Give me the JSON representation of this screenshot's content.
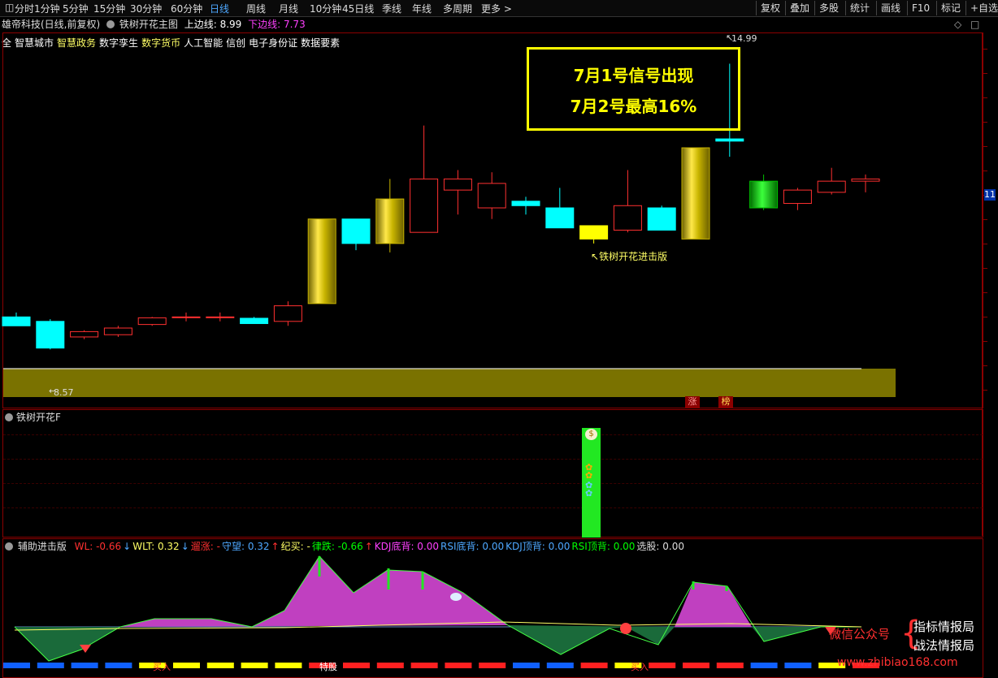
{
  "toolbar": {
    "items": [
      "分时",
      "1分钟",
      "5分钟",
      "15分钟",
      "30分钟",
      "60分钟",
      "日线",
      "周线",
      "月线",
      "10分钟",
      "45日线",
      "季线",
      "年线",
      "多周期",
      "更多 >"
    ],
    "active_index": 6,
    "right_buttons": [
      "复权",
      "叠加",
      "多股",
      "统计",
      "画线",
      "F10",
      "标记",
      "+自选"
    ]
  },
  "info": {
    "stock": "雄帝科技(日线,前复权)",
    "indicator": "铁树开花主图",
    "upper_label": "上边线:",
    "upper_value": "8.99",
    "lower_label": "下边线:",
    "lower_value": "7.73"
  },
  "concepts": [
    {
      "text": "全",
      "hl": false
    },
    {
      "text": "智慧城市",
      "hl": false
    },
    {
      "text": "智慧政务",
      "hl": true
    },
    {
      "text": "数字孪生",
      "hl": false
    },
    {
      "text": "数字货币",
      "hl": true
    },
    {
      "text": "人工智能",
      "hl": false
    },
    {
      "text": "信创",
      "hl": false
    },
    {
      "text": "电子身份证",
      "hl": false
    },
    {
      "text": "数据要素",
      "hl": false
    }
  ],
  "annotation": {
    "line1": "7月1号信号出现",
    "line2": "7月2号最高16%",
    "high_label": "14.99",
    "low_label": "8.57",
    "signal_label": "铁树开花进击版",
    "right_edge_label": "11",
    "tag_zhang": "涨",
    "tag_bang": "榜"
  },
  "colors": {
    "up": "#ff3030",
    "down": "#00ffff",
    "gold": "#c8b400",
    "signal_yellow": "#ffff00",
    "green": "#00c000",
    "band": "#7a7200",
    "magenta": "#c040c0",
    "sub_green": "#1a6a3a"
  },
  "panel2": {
    "title": "铁树开花F"
  },
  "panel3": {
    "title": "辅助进击版",
    "legend": [
      {
        "t": "WL: -0.66",
        "c": "#ff3030"
      },
      {
        "t": "↓",
        "c": "#4ea8ff"
      },
      {
        "t": "WLT: 0.32",
        "c": "#ffff66"
      },
      {
        "t": "↓",
        "c": "#4ea8ff"
      },
      {
        "t": "遛涨: -",
        "c": "#ff3030"
      },
      {
        "t": "守望: 0.32",
        "c": "#4ea8ff"
      },
      {
        "t": "↑",
        "c": "#ff3030"
      },
      {
        "t": "纪买: -",
        "c": "#ffff66"
      },
      {
        "t": "律跌: -0.66",
        "c": "#00ff00"
      },
      {
        "t": "↑",
        "c": "#ff3030"
      },
      {
        "t": "KDJ底背: 0.00",
        "c": "#ff40ff"
      },
      {
        "t": "RSI底背: 0.00",
        "c": "#4ea8ff"
      },
      {
        "t": "KDJ顶背: 0.00",
        "c": "#4ea8ff"
      },
      {
        "t": "RSI顶背: 0.00",
        "c": "#00ff00"
      },
      {
        "t": "选股: 0.00",
        "c": "#dddddd"
      }
    ],
    "bottom_labels": [
      "买入",
      "特股",
      "买入"
    ]
  },
  "watermark": {
    "left": "微信公众号",
    "right1": "指标情报局",
    "right2": "战法情报局",
    "url": "www.zhibiao168.com"
  },
  "chart_data": {
    "type": "candlestick",
    "price_range": [
      7.7,
      15.6
    ],
    "candles": [
      {
        "o": 9.3,
        "c": 9.1,
        "h": 9.4,
        "l": 9.1,
        "kind": "down"
      },
      {
        "o": 9.2,
        "c": 8.6,
        "h": 9.25,
        "l": 8.57,
        "kind": "down"
      },
      {
        "o": 8.85,
        "c": 8.97,
        "h": 9.0,
        "l": 8.8,
        "kind": "up"
      },
      {
        "o": 8.9,
        "c": 9.05,
        "h": 9.1,
        "l": 8.85,
        "kind": "up"
      },
      {
        "o": 9.13,
        "c": 9.28,
        "h": 9.3,
        "l": 9.1,
        "kind": "up"
      },
      {
        "o": 9.3,
        "c": 9.3,
        "h": 9.4,
        "l": 9.2,
        "kind": "flat"
      },
      {
        "o": 9.3,
        "c": 9.3,
        "h": 9.4,
        "l": 9.2,
        "kind": "flat"
      },
      {
        "o": 9.27,
        "c": 9.15,
        "h": 9.3,
        "l": 9.15,
        "kind": "down"
      },
      {
        "o": 9.2,
        "c": 9.55,
        "h": 9.65,
        "l": 9.1,
        "kind": "up"
      },
      {
        "o": 9.6,
        "c": 11.5,
        "h": 11.5,
        "l": 9.6,
        "kind": "gold"
      },
      {
        "o": 11.5,
        "c": 10.95,
        "h": 11.5,
        "l": 10.8,
        "kind": "down"
      },
      {
        "o": 10.95,
        "c": 11.95,
        "h": 12.4,
        "l": 10.75,
        "kind": "gold"
      },
      {
        "o": 11.2,
        "c": 12.4,
        "h": 13.6,
        "l": 11.2,
        "kind": "up"
      },
      {
        "o": 12.4,
        "c": 12.15,
        "h": 12.6,
        "l": 11.6,
        "kind": "up"
      },
      {
        "o": 12.3,
        "c": 11.75,
        "h": 12.55,
        "l": 11.5,
        "kind": "up"
      },
      {
        "o": 11.9,
        "c": 11.8,
        "h": 12.0,
        "l": 11.6,
        "kind": "down"
      },
      {
        "o": 11.75,
        "c": 11.3,
        "h": 12.2,
        "l": 11.3,
        "kind": "down"
      },
      {
        "o": 11.35,
        "c": 11.05,
        "h": 11.35,
        "l": 10.95,
        "kind": "signal"
      },
      {
        "o": 11.8,
        "c": 11.25,
        "h": 12.6,
        "l": 11.2,
        "kind": "up"
      },
      {
        "o": 11.75,
        "c": 11.25,
        "h": 11.8,
        "l": 11.25,
        "kind": "down"
      },
      {
        "o": 11.05,
        "c": 13.1,
        "h": 13.1,
        "l": 11.05,
        "kind": "gold"
      },
      {
        "o": 13.3,
        "c": 13.25,
        "h": 14.99,
        "l": 12.9,
        "kind": "down"
      },
      {
        "o": 12.35,
        "c": 11.75,
        "h": 12.5,
        "l": 11.7,
        "kind": "green"
      },
      {
        "o": 11.85,
        "c": 12.15,
        "h": 12.2,
        "l": 11.7,
        "kind": "up"
      },
      {
        "o": 12.1,
        "c": 12.35,
        "h": 12.65,
        "l": 12.05,
        "kind": "up"
      },
      {
        "o": 12.4,
        "c": 12.35,
        "h": 12.5,
        "l": 12.1,
        "kind": "up"
      }
    ]
  }
}
